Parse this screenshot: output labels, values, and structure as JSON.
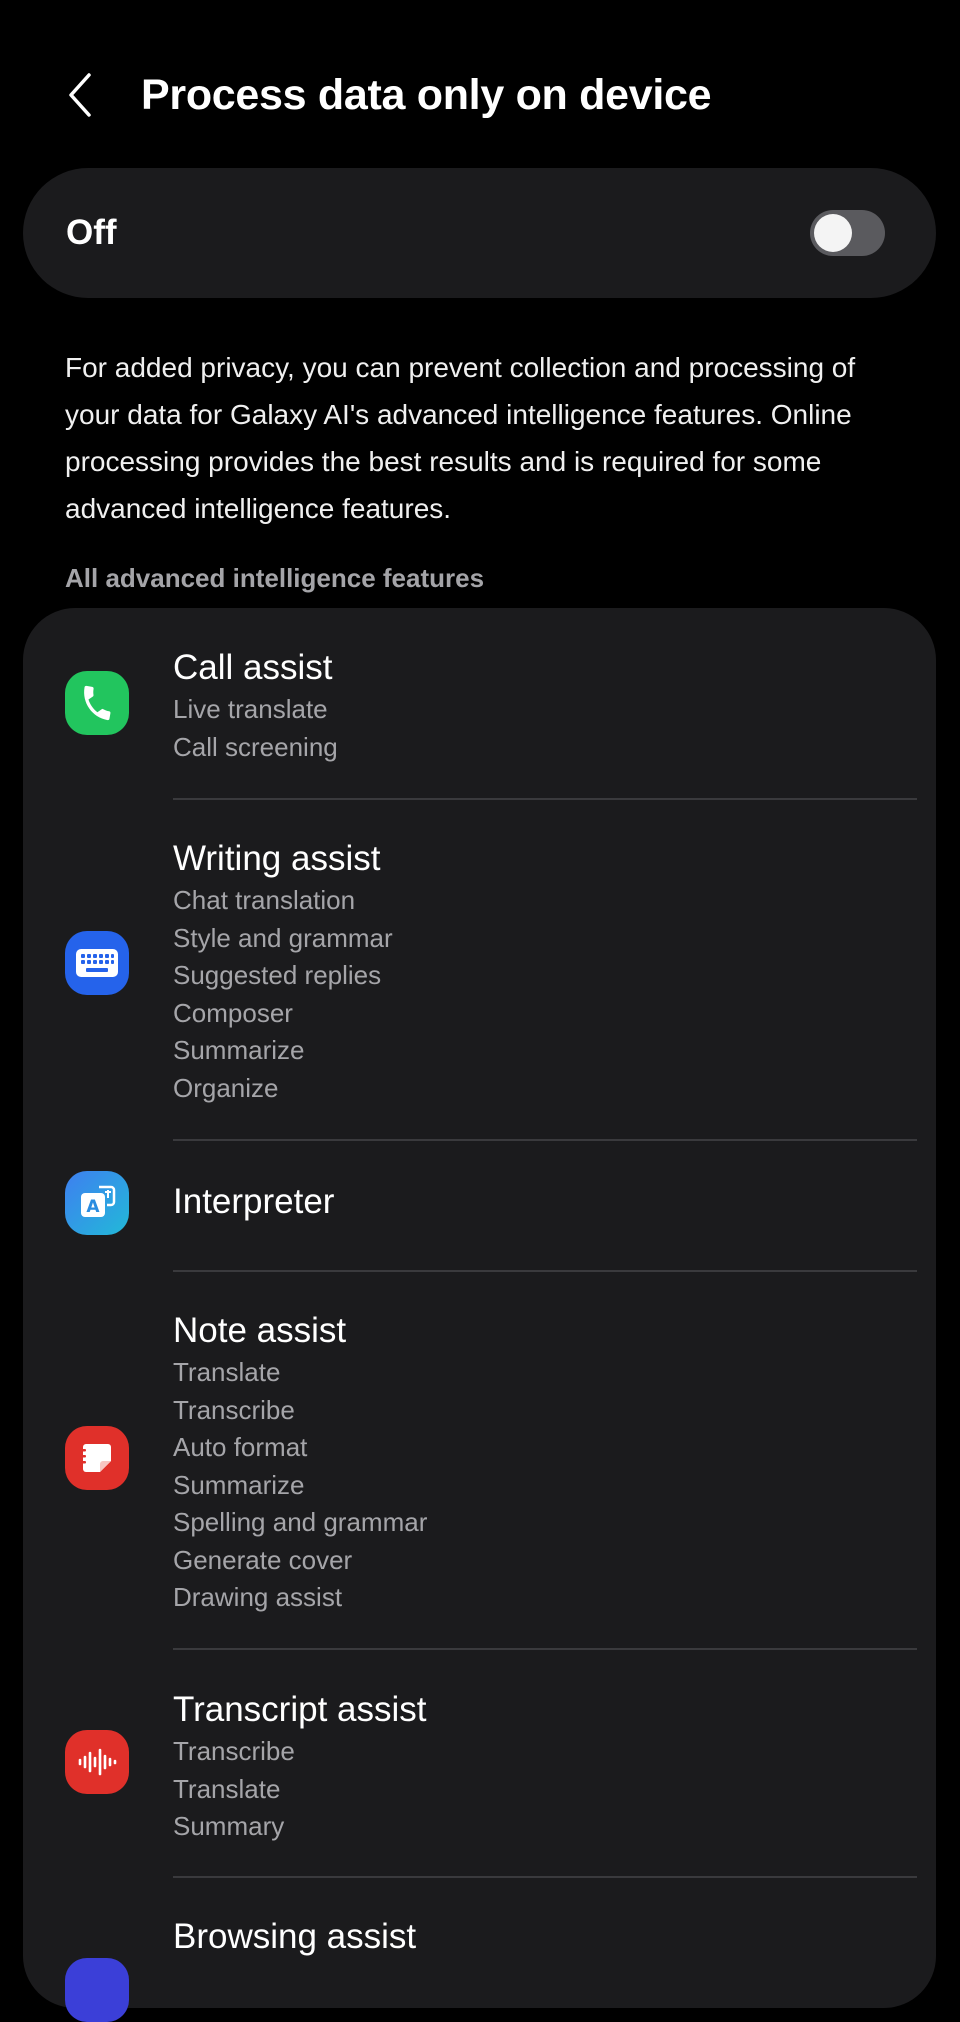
{
  "header": {
    "title": "Process data only on device"
  },
  "toggle": {
    "label": "Off",
    "checked": false
  },
  "description": "For added privacy, you can prevent collection and processing of your data for Galaxy AI's advanced intelligence features. Online processing provides the best results and is required for some advanced intelligence features.",
  "section_header": "All advanced intelligence features",
  "features": [
    {
      "title": "Call assist",
      "icon": "phone-icon",
      "color": "#22c55e",
      "items": [
        "Live translate",
        "Call screening"
      ]
    },
    {
      "title": "Writing assist",
      "icon": "keyboard-icon",
      "color": "#2563eb",
      "items": [
        "Chat translation",
        "Style and grammar",
        "Suggested replies",
        "Composer",
        "Summarize",
        "Organize"
      ]
    },
    {
      "title": "Interpreter",
      "icon": "translate-icon",
      "color": "#1ea5e0",
      "items": []
    },
    {
      "title": "Note assist",
      "icon": "notes-icon",
      "color": "#e0302a",
      "items": [
        "Translate",
        "Transcribe",
        "Auto format",
        "Summarize",
        "Spelling and grammar",
        "Generate cover",
        "Drawing assist"
      ]
    },
    {
      "title": "Transcript assist",
      "icon": "waveform-icon",
      "color": "#e0302a",
      "items": [
        "Transcribe",
        "Translate",
        "Summary"
      ]
    },
    {
      "title": "Browsing assist",
      "icon": "browser-icon",
      "color": "#3b3fd8",
      "items": []
    }
  ]
}
